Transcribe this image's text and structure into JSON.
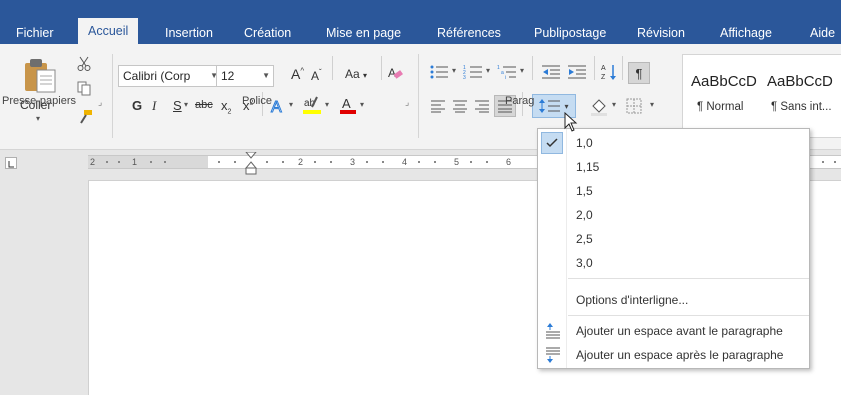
{
  "tabs": [
    "Fichier",
    "Accueil",
    "Insertion",
    "Création",
    "Mise en page",
    "Références",
    "Publipostage",
    "Révision",
    "Affichage",
    "Aide"
  ],
  "active_tab": "Accueil",
  "clipboard": {
    "label": "Presse-papiers",
    "paste_label": "Coller"
  },
  "font": {
    "label": "Police",
    "name": "Calibri (Corp",
    "size": "12",
    "case_label": "Aa",
    "bold": "G",
    "italic": "I",
    "underline": "S",
    "strike": "abc",
    "subscript": "x",
    "superscript": "x"
  },
  "paragraph": {
    "label": "Parag",
    "show_marks": "¶"
  },
  "styles": [
    {
      "preview": "AaBbCcD",
      "name": "¶ Normal"
    },
    {
      "preview": "AaBbCcD",
      "name": "¶ Sans int..."
    }
  ],
  "ruler": {
    "numbers": [
      "2",
      "1",
      "1",
      "2",
      "3",
      "4",
      "5",
      "6"
    ]
  },
  "line_spacing_menu": {
    "options": [
      "1,0",
      "1,15",
      "1,5",
      "2,0",
      "2,5",
      "3,0"
    ],
    "selected": "1,0",
    "options_label": "Options d'interligne...",
    "add_before": "Ajouter un espace avant le paragraphe",
    "add_after": "Ajouter un espace après le paragraphe"
  },
  "colors": {
    "tab_bar": "#2b579a",
    "ribbon": "#f3f3f3",
    "highlight_yellow": "#ffff00",
    "font_red": "#e00000",
    "check_bg": "#c5dcf2"
  }
}
